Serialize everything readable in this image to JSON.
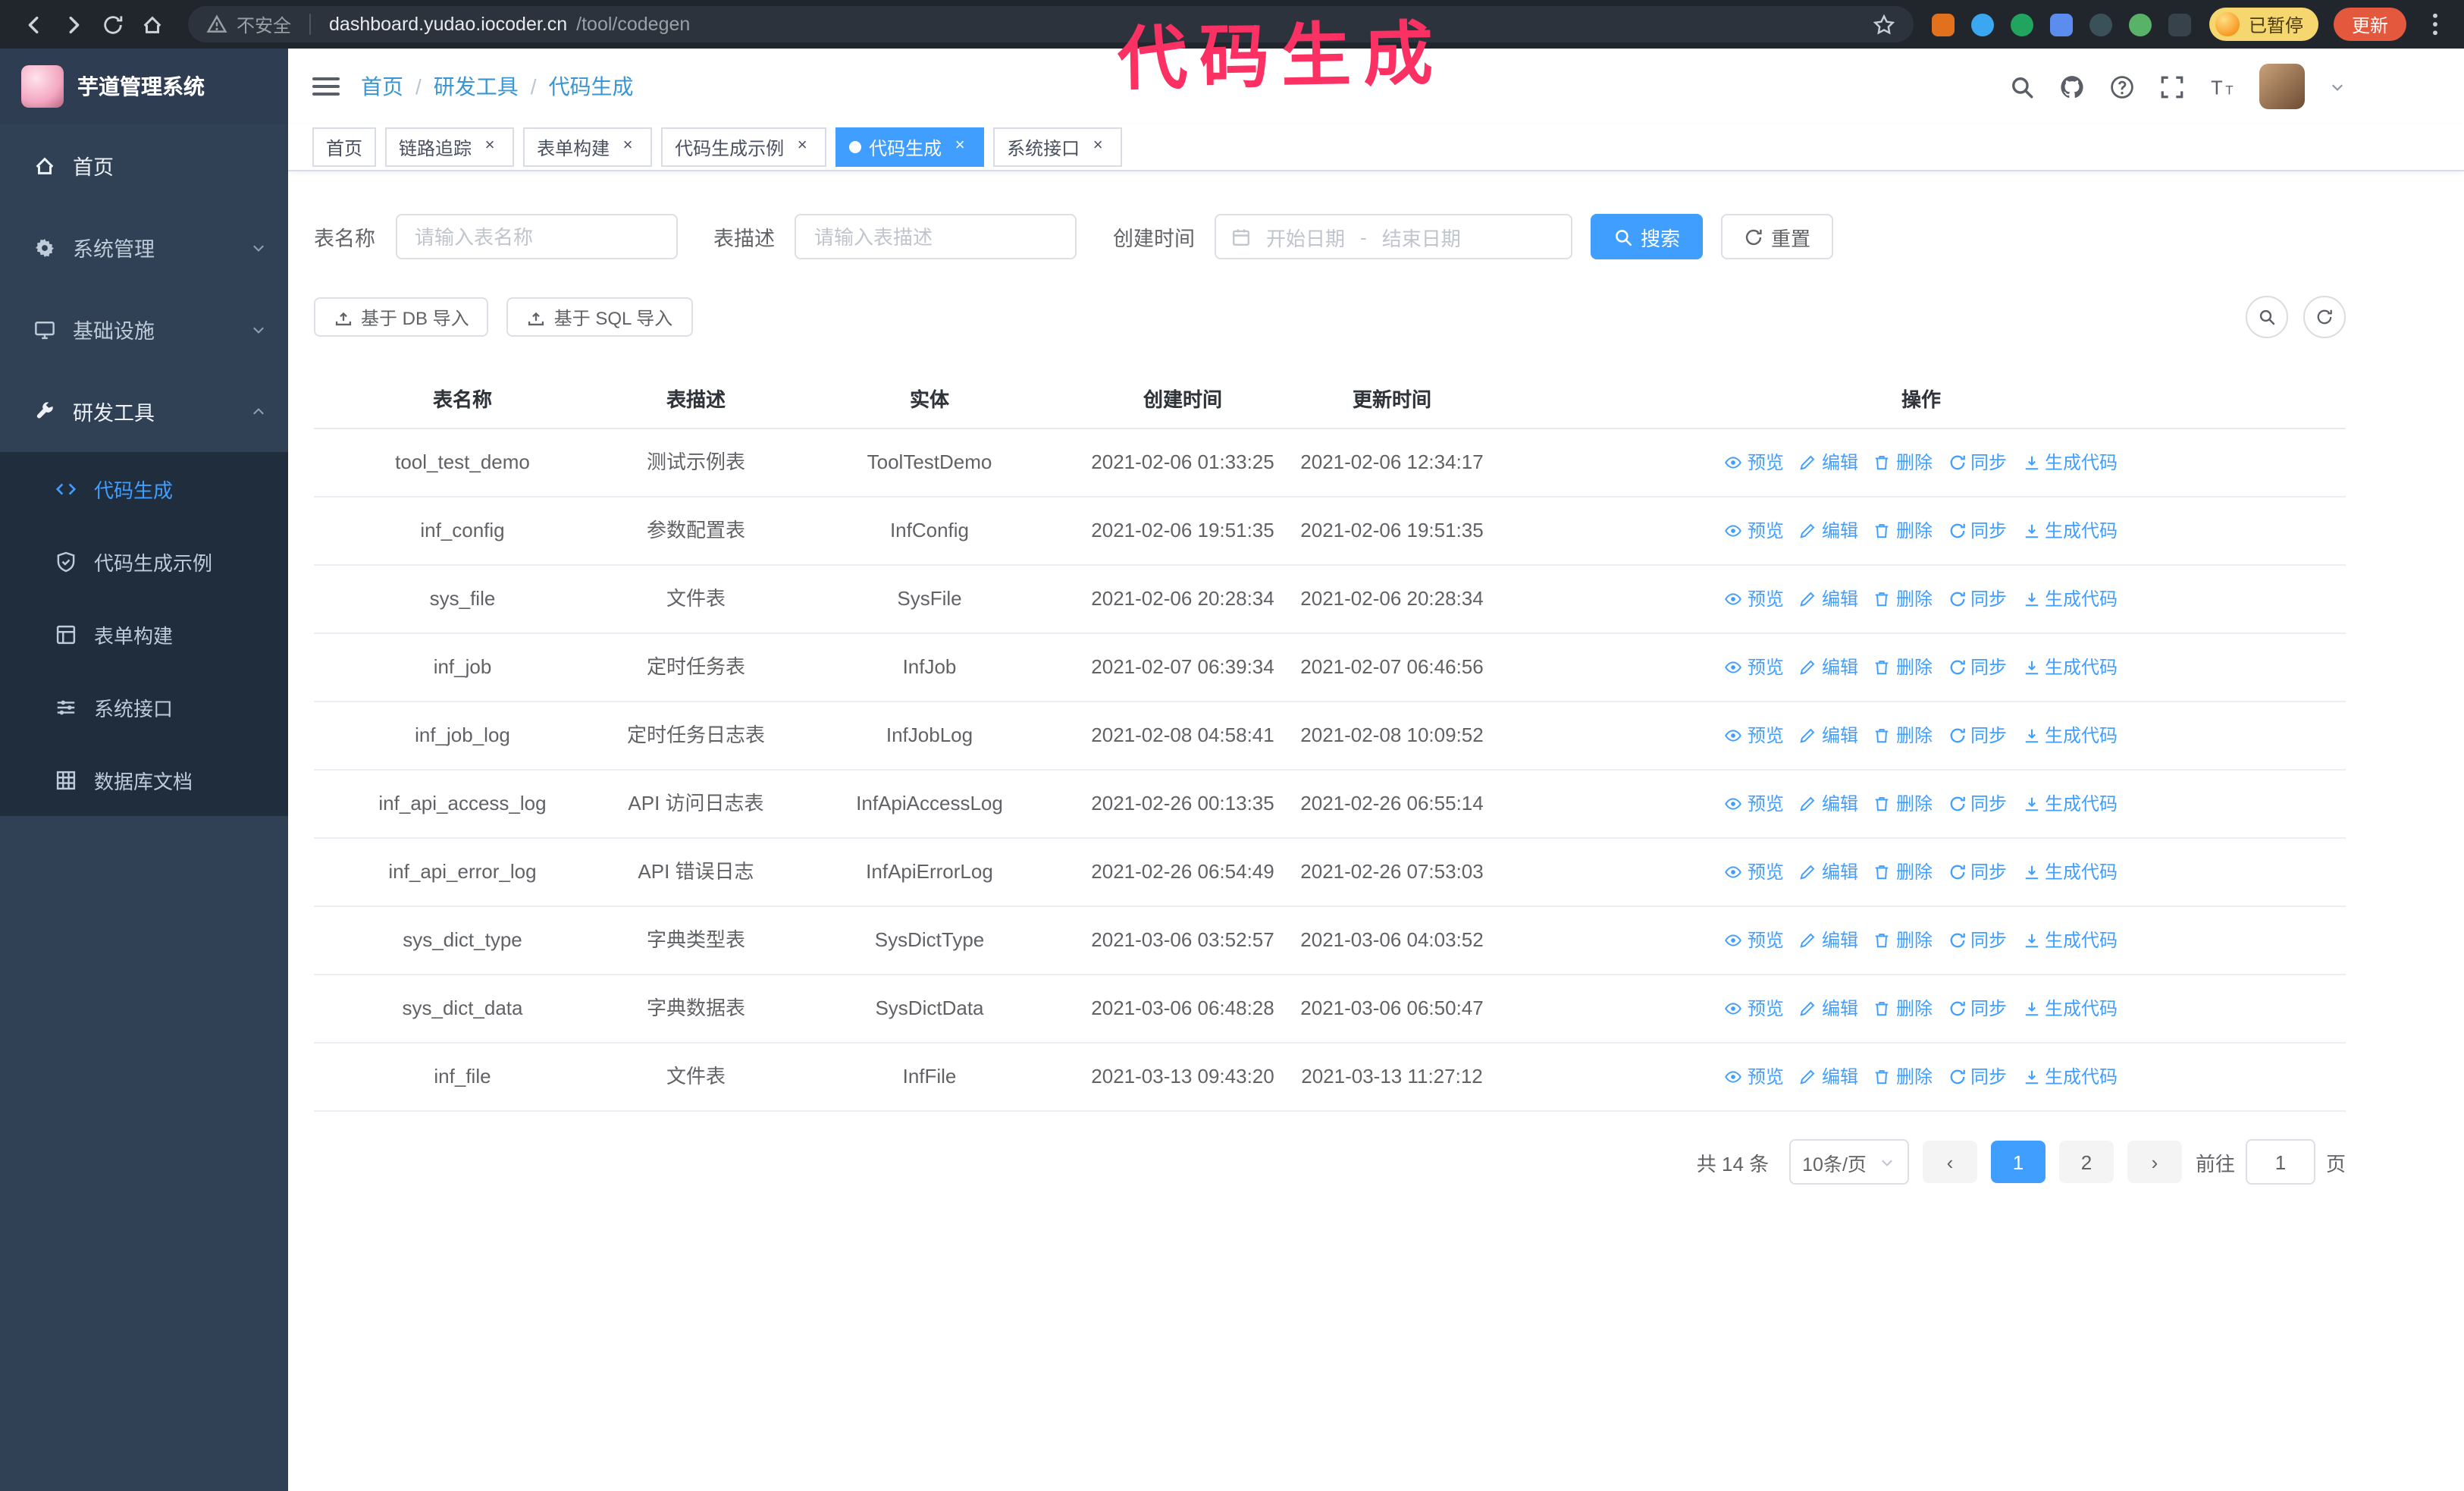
{
  "colors": {
    "primary": "#409eff",
    "annotation": "#fa3162",
    "sidebar_bg": "#304156",
    "submenu_bg": "#1f2d3d"
  },
  "annotation": "代码生成",
  "chrome": {
    "security_label": "不安全",
    "url_domain": "dashboard.yudao.iocoder.cn",
    "url_path": "/tool/codegen",
    "profile_badge": "已暂停",
    "update_button": "更新",
    "extensions": [
      {
        "key": "ext-1",
        "color": "#e2711d"
      },
      {
        "key": "ext-2",
        "color": "#3ba7f0"
      },
      {
        "key": "ext-3",
        "color": "#21a45d"
      },
      {
        "key": "ext-4",
        "color": "#5b8def"
      },
      {
        "key": "ext-5",
        "color": "#3b5159"
      },
      {
        "key": "ext-6",
        "color": "#58b368"
      },
      {
        "key": "ext-7",
        "color": "#37424a"
      }
    ]
  },
  "sidebar": {
    "logo_title": "芋道管理系统",
    "items": [
      {
        "key": "home",
        "label": "首页",
        "icon": "home",
        "bright": true
      },
      {
        "key": "system",
        "label": "系统管理",
        "icon": "gear",
        "chevron": "down"
      },
      {
        "key": "infra",
        "label": "基础设施",
        "icon": "monitor",
        "chevron": "down"
      },
      {
        "key": "devtools",
        "label": "研发工具",
        "icon": "wrench",
        "chevron": "up",
        "bright": true,
        "expanded": true
      }
    ],
    "subitems": [
      {
        "key": "codegen",
        "label": "代码生成",
        "icon": "code",
        "active": true
      },
      {
        "key": "codegen-demo",
        "label": "代码生成示例",
        "icon": "shield"
      },
      {
        "key": "form-builder",
        "label": "表单构建",
        "icon": "form"
      },
      {
        "key": "api",
        "label": "系统接口",
        "icon": "sliders"
      },
      {
        "key": "db-doc",
        "label": "数据库文档",
        "icon": "grid"
      }
    ]
  },
  "header": {
    "breadcrumb": [
      {
        "label": "首页"
      },
      {
        "label": "研发工具"
      },
      {
        "label": "代码生成"
      }
    ]
  },
  "tabs": [
    {
      "key": "home",
      "label": "首页",
      "closable": false,
      "active": false
    },
    {
      "key": "tracer",
      "label": "链路追踪",
      "closable": true,
      "active": false
    },
    {
      "key": "form-builder",
      "label": "表单构建",
      "closable": true,
      "active": false
    },
    {
      "key": "codegen-demo",
      "label": "代码生成示例",
      "closable": true,
      "active": false
    },
    {
      "key": "codegen",
      "label": "代码生成",
      "closable": true,
      "active": true
    },
    {
      "key": "api",
      "label": "系统接口",
      "closable": true,
      "active": false
    }
  ],
  "search_form": {
    "table_name_label": "表名称",
    "table_name_placeholder": "请输入表名称",
    "table_desc_label": "表描述",
    "table_desc_placeholder": "请输入表描述",
    "create_time_label": "创建时间",
    "start_date_placeholder": "开始日期",
    "range_separator": "-",
    "end_date_placeholder": "结束日期",
    "search_button": "搜索",
    "reset_button": "重置"
  },
  "toolbar": {
    "import_db_button": "基于 DB 导入",
    "import_sql_button": "基于 SQL 导入"
  },
  "table": {
    "columns": [
      "表名称",
      "表描述",
      "实体",
      "创建时间",
      "更新时间",
      "操作"
    ],
    "actions": [
      {
        "key": "preview",
        "label": "预览",
        "icon": "eye"
      },
      {
        "key": "edit",
        "label": "编辑",
        "icon": "edit"
      },
      {
        "key": "delete",
        "label": "删除",
        "icon": "trash"
      },
      {
        "key": "sync",
        "label": "同步",
        "icon": "refresh"
      },
      {
        "key": "generate",
        "label": "生成代码",
        "icon": "download"
      }
    ],
    "rows": [
      {
        "name": "tool_test_demo",
        "desc": "测试示例表",
        "entity": "ToolTestDemo",
        "created": "2021-02-06 01:33:25",
        "updated": "2021-02-06 12:34:17"
      },
      {
        "name": "inf_config",
        "desc": "参数配置表",
        "entity": "InfConfig",
        "created": "2021-02-06 19:51:35",
        "updated": "2021-02-06 19:51:35"
      },
      {
        "name": "sys_file",
        "desc": "文件表",
        "entity": "SysFile",
        "created": "2021-02-06 20:28:34",
        "updated": "2021-02-06 20:28:34"
      },
      {
        "name": "inf_job",
        "desc": "定时任务表",
        "entity": "InfJob",
        "created": "2021-02-07 06:39:34",
        "updated": "2021-02-07 06:46:56"
      },
      {
        "name": "inf_job_log",
        "desc": "定时任务日志表",
        "entity": "InfJobLog",
        "created": "2021-02-08 04:58:41",
        "updated": "2021-02-08 10:09:52"
      },
      {
        "name": "inf_api_access_log",
        "desc": "API 访问日志表",
        "entity": "InfApiAccessLog",
        "created": "2021-02-26 00:13:35",
        "updated": "2021-02-26 06:55:14"
      },
      {
        "name": "inf_api_error_log",
        "desc": "API 错误日志",
        "entity": "InfApiErrorLog",
        "created": "2021-02-26 06:54:49",
        "updated": "2021-02-26 07:53:03"
      },
      {
        "name": "sys_dict_type",
        "desc": "字典类型表",
        "entity": "SysDictType",
        "created": "2021-03-06 03:52:57",
        "updated": "2021-03-06 04:03:52"
      },
      {
        "name": "sys_dict_data",
        "desc": "字典数据表",
        "entity": "SysDictData",
        "created": "2021-03-06 06:48:28",
        "updated": "2021-03-06 06:50:47"
      },
      {
        "name": "inf_file",
        "desc": "文件表",
        "entity": "InfFile",
        "created": "2021-03-13 09:43:20",
        "updated": "2021-03-13 11:27:12"
      }
    ]
  },
  "pagination": {
    "total_label": "共 14 条",
    "page_size_label": "10条/页",
    "pages": [
      "1",
      "2"
    ],
    "active_page": "1",
    "prev_label": "‹",
    "next_label": "›",
    "goto_label": "前往",
    "goto_value": "1",
    "goto_unit": "页"
  }
}
